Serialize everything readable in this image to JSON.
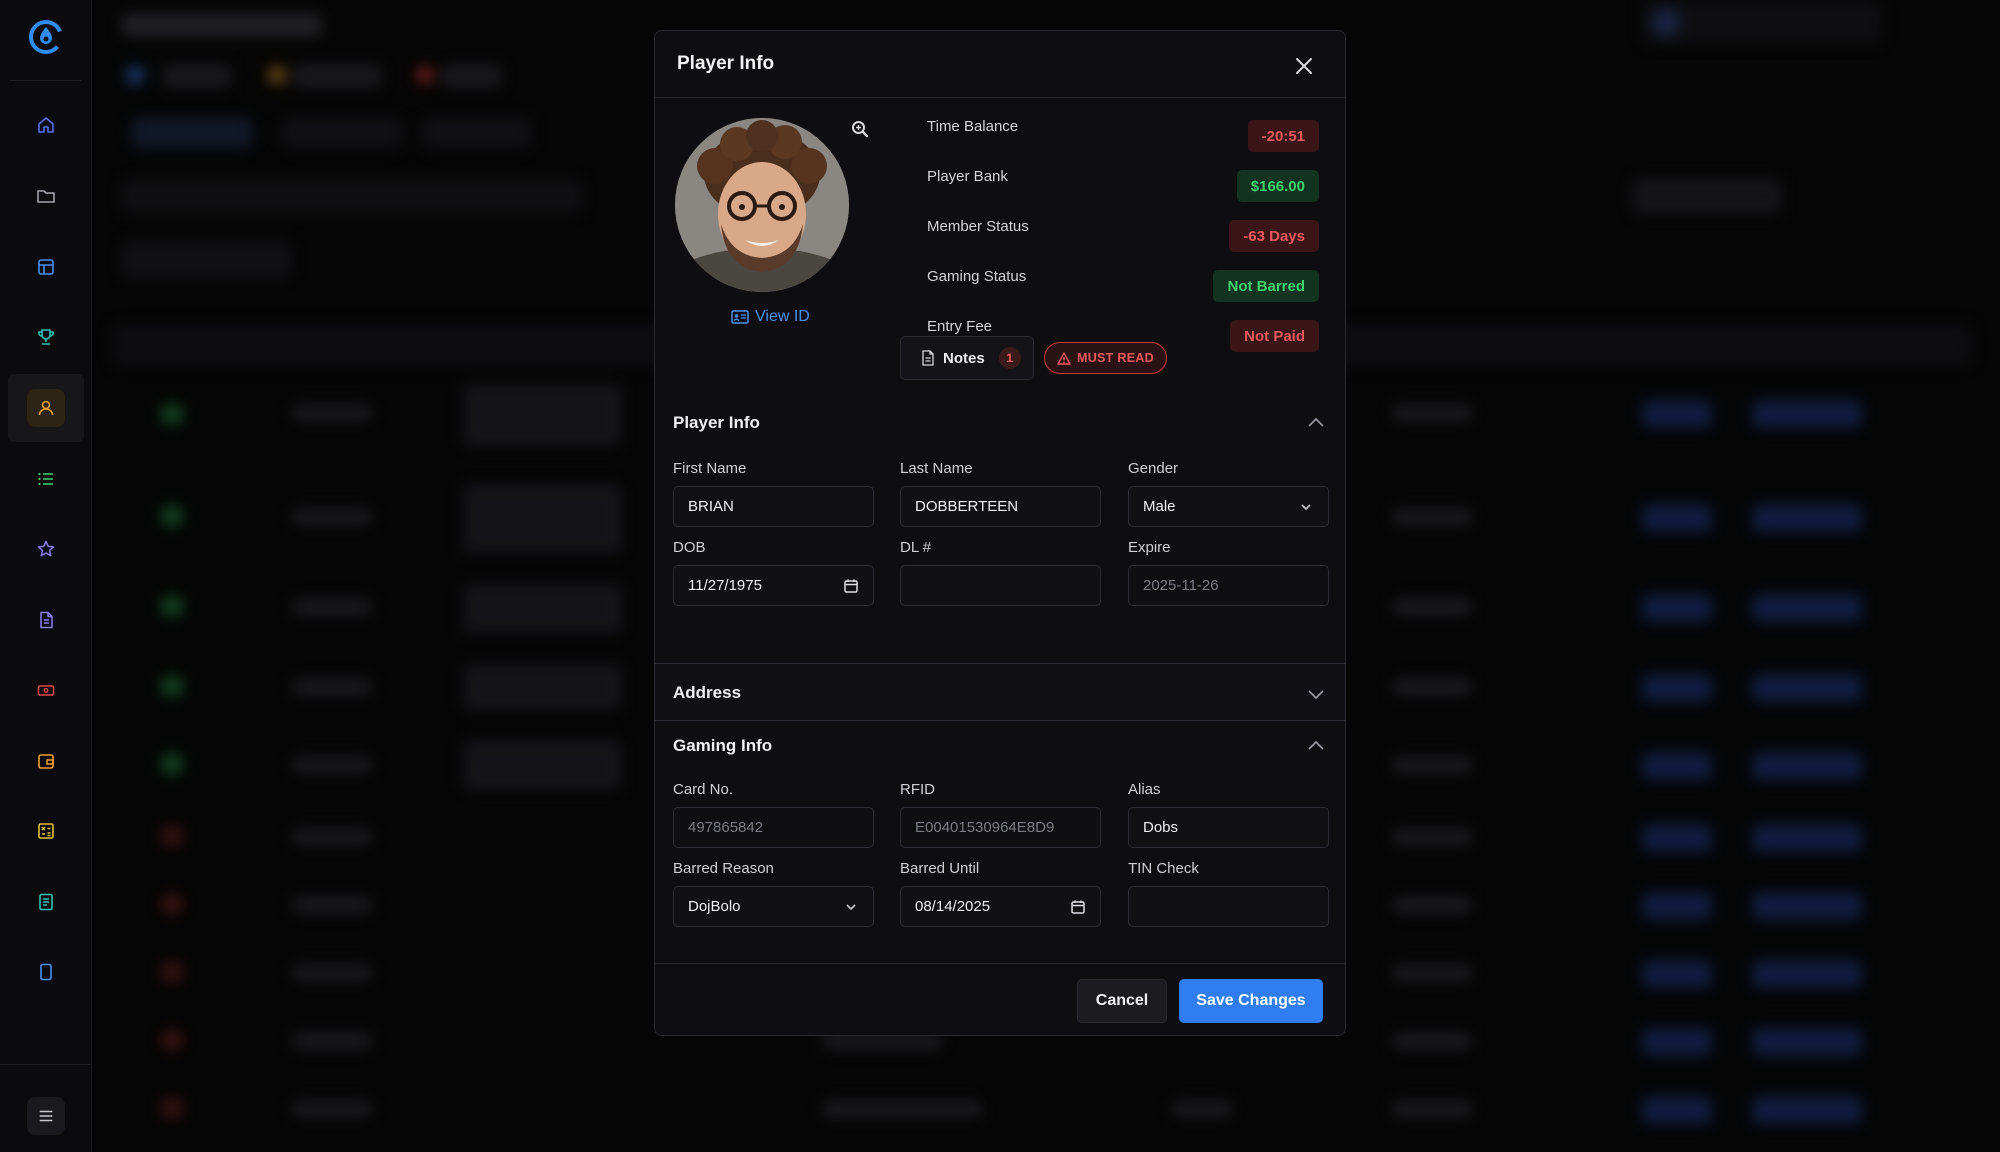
{
  "colors": {
    "accent": "#2f7df0",
    "danger": "#f0595e",
    "success": "#3fd26e",
    "background": "#050505",
    "modal": "#0e0e11"
  },
  "sidebar": {
    "logo_icon": "brand-logo-icon",
    "items": [
      {
        "icon": "home-icon",
        "color": "#5b6cf0"
      },
      {
        "icon": "folder-icon",
        "color": "#a1a1aa"
      },
      {
        "icon": "layout-icon",
        "color": "#4a8ef0"
      },
      {
        "icon": "trophy-icon",
        "color": "#2ec4b6"
      },
      {
        "icon": "user-icon",
        "color": "#f0a030",
        "active": true
      },
      {
        "icon": "list-icon",
        "color": "#3fd26e"
      },
      {
        "icon": "star-icon",
        "color": "#8b7cf6"
      },
      {
        "icon": "document-icon",
        "color": "#8b7cf6"
      },
      {
        "icon": "ticket-icon",
        "color": "#e0464b"
      },
      {
        "icon": "wallet-icon",
        "color": "#f0a030"
      },
      {
        "icon": "calculator-icon",
        "color": "#e0c030"
      },
      {
        "icon": "receipt-icon",
        "color": "#2ec4b6"
      },
      {
        "icon": "tablet-icon",
        "color": "#4a8ef0"
      }
    ],
    "menu_icon": "hamburger-icon"
  },
  "modal": {
    "title": "Player Info",
    "view_id_label": "View ID",
    "stats": [
      {
        "label": "Time Balance",
        "value": "-20:51",
        "tone": "red"
      },
      {
        "label": "Player Bank",
        "value": "$166.00",
        "tone": "green"
      },
      {
        "label": "Member Status",
        "value": "-63 Days",
        "tone": "red"
      },
      {
        "label": "Gaming Status",
        "value": "Not Barred",
        "tone": "green"
      },
      {
        "label": "Entry Fee",
        "value": "Not Paid",
        "tone": "red"
      }
    ],
    "notes_label": "Notes",
    "notes_count": "1",
    "must_read_label": "MUST READ",
    "player_info": {
      "title": "Player Info",
      "first_name_label": "First Name",
      "first_name": "BRIAN",
      "last_name_label": "Last Name",
      "last_name": "DOBBERTEEN",
      "gender_label": "Gender",
      "gender": "Male",
      "dob_label": "DOB",
      "dob": "11/27/1975",
      "dl_label": "DL #",
      "dl": "",
      "expire_label": "Expire",
      "expire": "2025-11-26"
    },
    "address": {
      "title": "Address"
    },
    "gaming_info": {
      "title": "Gaming Info",
      "card_label": "Card No.",
      "card": "497865842",
      "rfid_label": "RFID",
      "rfid": "E00401530964E8D9",
      "alias_label": "Alias",
      "alias": "Dobs",
      "barred_reason_label": "Barred Reason",
      "barred_reason": "DojBolo",
      "barred_until_label": "Barred Until",
      "barred_until": "08/14/2025",
      "tin_label": "TIN Check",
      "tin": ""
    },
    "cancel_label": "Cancel",
    "save_label": "Save Changes"
  }
}
